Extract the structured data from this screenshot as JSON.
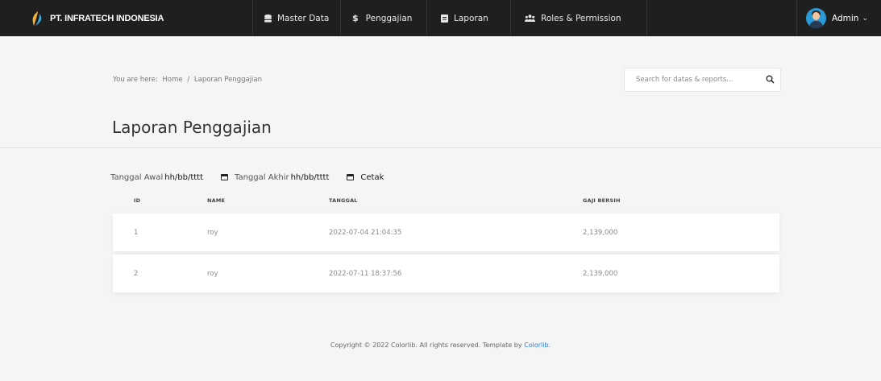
{
  "navbar": {
    "brand": "PT. INFRATECH INDONESIA",
    "menu": [
      {
        "label": "Master Data",
        "icon": "database-icon"
      },
      {
        "label": "Penggajian",
        "icon": "dollar-icon"
      },
      {
        "label": "Laporan",
        "icon": "document-icon"
      },
      {
        "label": "Roles & Permission",
        "icon": "users-icon"
      }
    ],
    "user": "Admin",
    "user_chevron": "⌄"
  },
  "breadcrumb": {
    "prefix": "You are here:",
    "home": "Home",
    "separator": "/",
    "current": "Laporan Penggajian"
  },
  "search": {
    "placeholder": "Search for datas & reports..."
  },
  "page": {
    "title": "Laporan Penggajian"
  },
  "filter": {
    "start_label": "Tanggal Awal",
    "start_value": "hh/bb/tttt",
    "end_label": "Tanggal Akhir",
    "end_value": "hh/bb/tttt",
    "print_label": "Cetak"
  },
  "table": {
    "headers": [
      "ID",
      "NAME",
      "TANGGAL",
      "GAJI BERSIH"
    ],
    "rows": [
      [
        "1",
        "roy",
        "2022-07-04 21:04:35",
        "2,139,000"
      ],
      [
        "2",
        "roy",
        "2022-07-11 18:37:56",
        "2,139,000"
      ]
    ]
  },
  "footer": {
    "text": "Copyright © 2022 Colorlib. All rights reserved. Template by",
    "link": "Colorlib."
  },
  "colors": {
    "navbar_bg": "#1f1f1f",
    "page_bg": "#f5f5f5",
    "link": "#2f7cd6"
  }
}
